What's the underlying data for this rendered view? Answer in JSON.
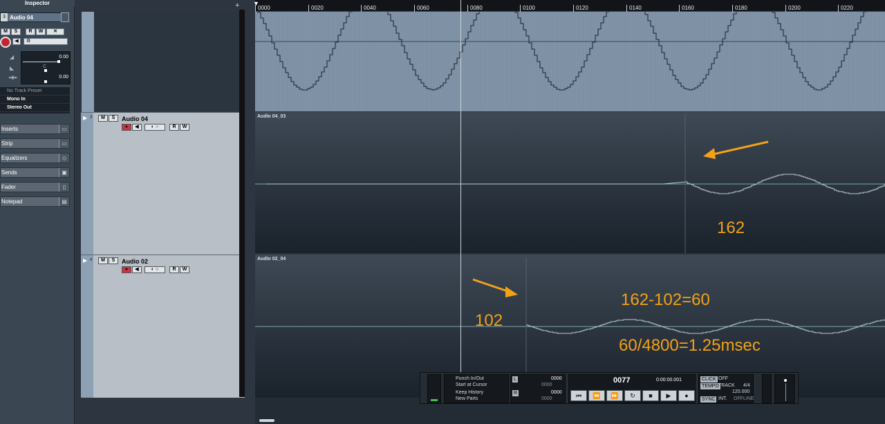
{
  "inspector": {
    "title": "Inspector",
    "track_number": "3",
    "track_name": "Audio 04",
    "btn_m": "M",
    "btn_s": "S",
    "btn_r": "R",
    "btn_w": "W",
    "volume_value": "0.00",
    "pan_value": "C",
    "delay_value": "0.00",
    "preset": "No Track Preset",
    "input": "Mono In",
    "output": "Stereo Out",
    "sections": [
      "Inserts",
      "Strip",
      "Equalizers",
      "Sends",
      "Fader",
      "Notepad"
    ]
  },
  "tracks": [
    {
      "number": "3",
      "name": "Audio 04"
    },
    {
      "number": "4",
      "name": "Audio 02"
    }
  ],
  "ruler": {
    "ticks": [
      "0000",
      "0020",
      "0040",
      "0060",
      "0080",
      "0100",
      "0120",
      "0140",
      "0160",
      "0180",
      "0200",
      "0220"
    ]
  },
  "events": {
    "event2": "Audio 04_03",
    "event3": "Audio 02_04"
  },
  "annotations": {
    "a1": "162",
    "a2": "102",
    "a3": "162-102=60",
    "a4": "60/4800=1.25msec",
    "color": "#f3a215"
  },
  "transport": {
    "punch": "Punch In/Out",
    "start_cursor": "Start at Cursor",
    "keep_history": "Keep History",
    "new_parts": "New Parts",
    "l_label": "L",
    "l_value": "0000",
    "l_sub": "0000",
    "r_label": "R",
    "r_value": "0000",
    "r_sub": "0000",
    "position": "0077",
    "time": "0:00:00.001",
    "click": "CLICK",
    "click_state": "OFF",
    "tempo": "TEMPO",
    "tempo_mode": "TRACK",
    "signature": "4/4",
    "bpm": "120.000",
    "sync": "SYNC",
    "sync_mode": "INT.",
    "sync_state": "OFFLINE"
  }
}
